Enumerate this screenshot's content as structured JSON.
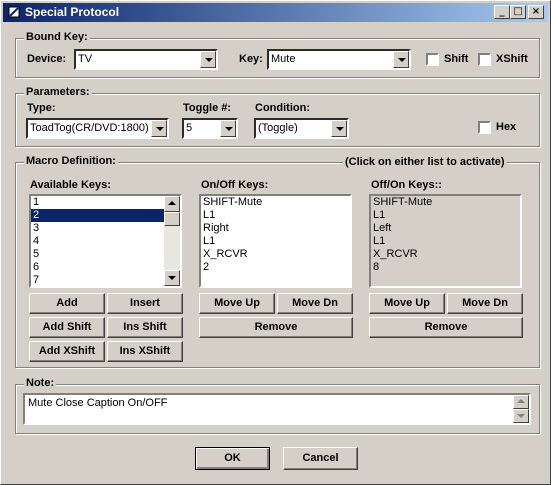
{
  "window": {
    "title": "Special Protocol",
    "icon": "wrench-icon",
    "controls": {
      "minimize": "_",
      "maximize": "□",
      "close": "×"
    }
  },
  "bound_key": {
    "group_label": "Bound Key:",
    "device_label": "Device:",
    "device_value": "TV",
    "key_label": "Key:",
    "key_value": "Mute",
    "shift_label": "Shift",
    "shift_checked": false,
    "xshift_label": "XShift",
    "xshift_checked": false
  },
  "parameters": {
    "group_label": "Parameters:",
    "type_label": "Type:",
    "type_value": "ToadTog(CR/DVD:1800)",
    "toggle_label": "Toggle #:",
    "toggle_value": "5",
    "condition_label": "Condition:",
    "condition_value": "(Toggle)",
    "hex_label": "Hex",
    "hex_checked": false
  },
  "macro": {
    "group_label": "Macro Definition:",
    "hint": "(Click on either list to activate)",
    "available_label": "Available Keys:",
    "available_items": [
      "1",
      "2",
      "3",
      "4",
      "5",
      "6",
      "7"
    ],
    "available_selected_index": 1,
    "onoff_label": "On/Off Keys:",
    "onoff_items": [
      "SHIFT-Mute",
      "L1",
      "Right",
      "L1",
      "X_RCVR",
      "2"
    ],
    "offon_label": "Off/On Keys::",
    "offon_items": [
      "SHIFT-Mute",
      "L1",
      "Left",
      "L1",
      "X_RCVR",
      "8"
    ],
    "buttons": {
      "add": "Add",
      "insert": "Insert",
      "add_shift": "Add Shift",
      "ins_shift": "Ins Shift",
      "add_xshift": "Add XShift",
      "ins_xshift": "Ins XShift",
      "move_up": "Move Up",
      "move_dn": "Move Dn",
      "remove": "Remove"
    }
  },
  "note": {
    "group_label": "Note:",
    "value": "Mute Close Caption On/OFF"
  },
  "footer": {
    "ok": "OK",
    "cancel": "Cancel"
  }
}
